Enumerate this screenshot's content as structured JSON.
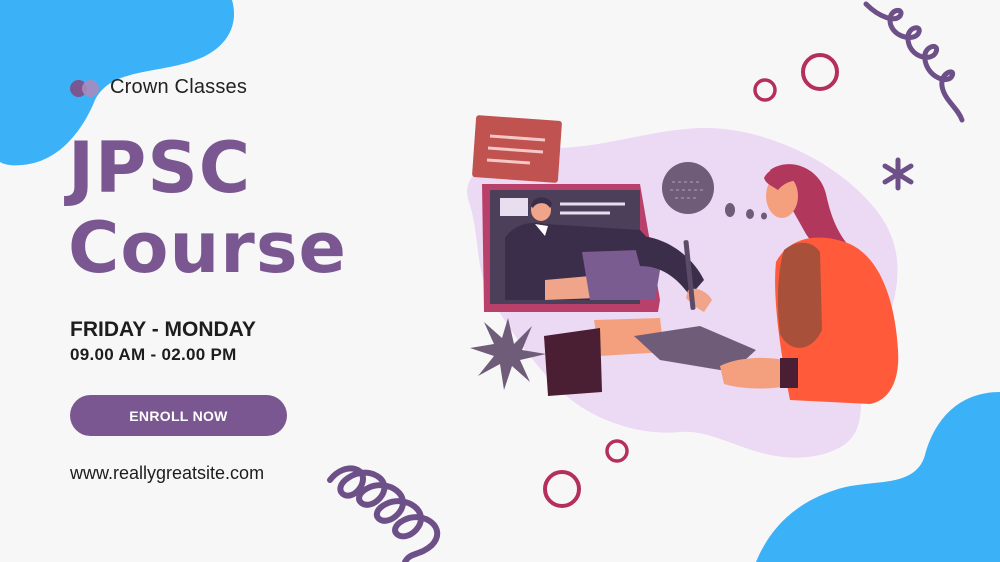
{
  "brand": {
    "name": "Crown Classes",
    "logo_icon": "two-circles-logo"
  },
  "hero": {
    "title_line1": "JPSC",
    "title_line2": "Course",
    "schedule_days": "FRIDAY - MONDAY",
    "schedule_hours": "09.00 AM - 02.00 PM",
    "cta_label": "ENROLL NOW",
    "website": "www.reallygreatsite.com"
  },
  "colors": {
    "accent_purple": "#7a5790",
    "blob_blue": "#3bb2f7",
    "ring_red": "#b4305b",
    "lilac": "#ecd9f3"
  }
}
